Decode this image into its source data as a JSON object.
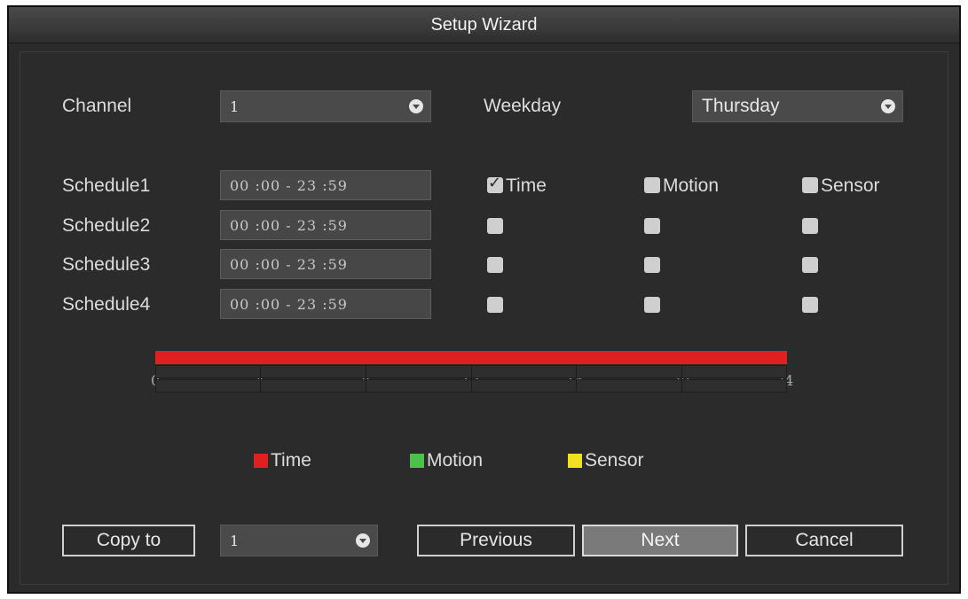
{
  "window": {
    "title": "Setup Wizard"
  },
  "channel": {
    "label": "Channel",
    "value": "1"
  },
  "weekday": {
    "label": "Weekday",
    "value": "Thursday"
  },
  "schedules": [
    {
      "label": "Schedule1",
      "time": "00 :00 - 23 :59",
      "time_checked": true,
      "motion_checked": false,
      "sensor_checked": false
    },
    {
      "label": "Schedule2",
      "time": "00 :00 - 23 :59",
      "time_checked": false,
      "motion_checked": false,
      "sensor_checked": false
    },
    {
      "label": "Schedule3",
      "time": "00 :00 - 23 :59",
      "time_checked": false,
      "motion_checked": false,
      "sensor_checked": false
    },
    {
      "label": "Schedule4",
      "time": "00 :00 - 23 :59",
      "time_checked": false,
      "motion_checked": false,
      "sensor_checked": false
    }
  ],
  "column_labels": {
    "time": "Time",
    "motion": "Motion",
    "sensor": "Sensor"
  },
  "timeline": {
    "ticks": [
      "0",
      "4",
      "8",
      "12",
      "16",
      "20",
      "24"
    ],
    "time_coverage": [
      0,
      24
    ]
  },
  "legend": {
    "time": {
      "label": "Time",
      "color": "#e02020"
    },
    "motion": {
      "label": "Motion",
      "color": "#4cc24c"
    },
    "sensor": {
      "label": "Sensor",
      "color": "#f0e020"
    }
  },
  "footer": {
    "copy_to_label": "Copy to",
    "copy_to_value": "1",
    "previous_label": "Previous",
    "next_label": "Next",
    "cancel_label": "Cancel"
  }
}
